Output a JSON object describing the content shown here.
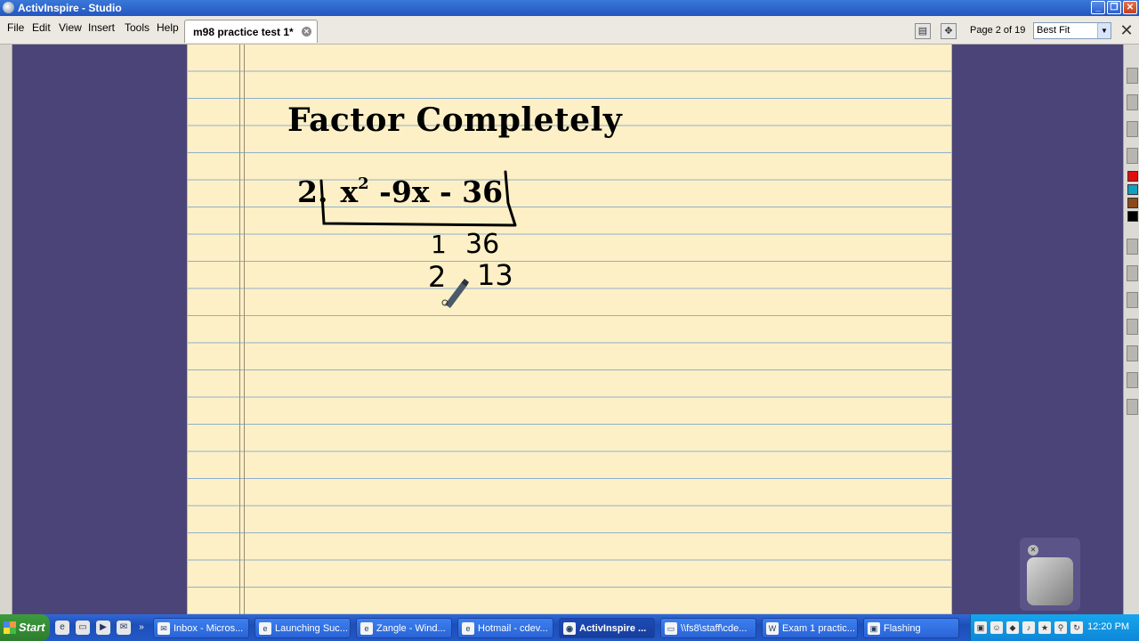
{
  "window": {
    "title": "ActivInspire - Studio",
    "controls": {
      "minimize": "_",
      "maximize": "❐",
      "close": "✕"
    }
  },
  "menu": [
    {
      "label": "File"
    },
    {
      "label": "Edit"
    },
    {
      "label": "View"
    },
    {
      "label": "Insert"
    },
    {
      "label": "Tools"
    },
    {
      "label": "Help"
    }
  ],
  "document_tab": {
    "label": "m98 practice test 1*"
  },
  "toolbar": {
    "page_indicator": "Page 2 of 19",
    "zoom_value": "Best Fit"
  },
  "flipchart": {
    "heading": "Factor Completely",
    "problem_number": "2.",
    "problem_x": "x",
    "problem_exponent": "2",
    "problem_rest": " -9x - 36",
    "handwritten": {
      "row1_left": "1",
      "row1_right": "36",
      "row2_left": "2",
      "row2_right": "13"
    }
  },
  "palette_colors": [
    "#e01010",
    "#10a0c0",
    "#8a4a1a",
    "#000000"
  ],
  "taskbar": {
    "start_label": "Start",
    "tasks": [
      {
        "label": "Inbox - Micros...",
        "icon": "outlook-icon",
        "active": false
      },
      {
        "label": "Launching Suc...",
        "icon": "ie-icon",
        "active": false
      },
      {
        "label": "Zangle - Wind...",
        "icon": "ie-icon",
        "active": false
      },
      {
        "label": "Hotmail - cdev...",
        "icon": "ie-icon",
        "active": false
      },
      {
        "label": "ActivInspire ...",
        "icon": "activinspire-icon",
        "active": true
      },
      {
        "label": "\\\\fs8\\staff\\cde...",
        "icon": "folder-icon",
        "active": false
      },
      {
        "label": "Exam 1 practic...",
        "icon": "word-icon",
        "active": false
      },
      {
        "label": "Flashing",
        "icon": "app-icon",
        "active": false
      }
    ],
    "clock": "12:20 PM"
  }
}
